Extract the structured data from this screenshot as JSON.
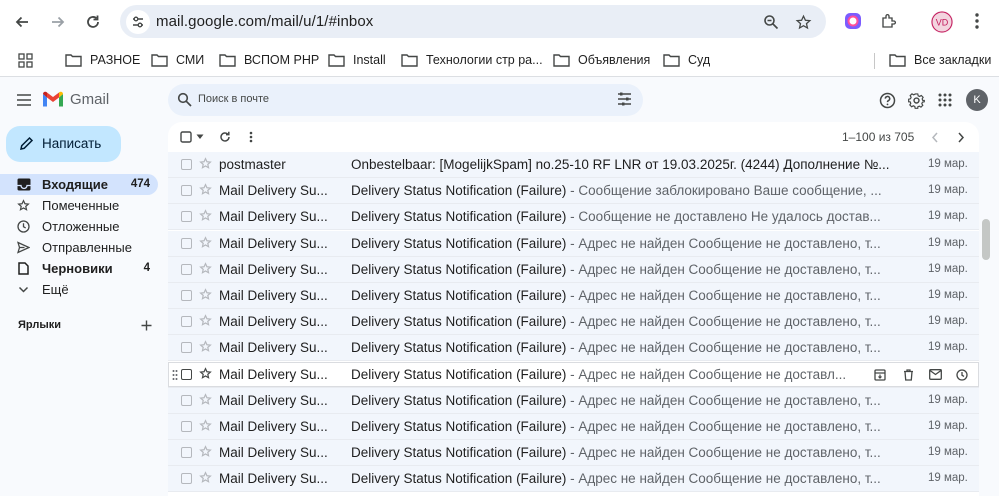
{
  "browser": {
    "url": "mail.google.com/mail/u/1/#inbox",
    "profile_initials": "VD",
    "bookmarks": [
      {
        "label": "РАЗНОЕ"
      },
      {
        "label": "СМИ"
      },
      {
        "label": "ВСПОМ PHP"
      },
      {
        "label": "Install"
      },
      {
        "label": "Технологии стр ра..."
      },
      {
        "label": "Объявления"
      },
      {
        "label": "Суд"
      }
    ],
    "all_bookmarks": "Все закладки"
  },
  "gmail": {
    "logo_text": "Gmail",
    "search_placeholder": "Поиск в почте",
    "account_initial": "K",
    "compose_label": "Написать",
    "nav": [
      {
        "label": "Входящие",
        "count": "474",
        "icon": "inbox-icon",
        "active": true,
        "bold": true
      },
      {
        "label": "Помеченные",
        "count": "",
        "icon": "star-icon",
        "active": false,
        "bold": false
      },
      {
        "label": "Отложенные",
        "count": "",
        "icon": "clock-icon",
        "active": false,
        "bold": false
      },
      {
        "label": "Отправленные",
        "count": "",
        "icon": "send-icon",
        "active": false,
        "bold": false
      },
      {
        "label": "Черновики",
        "count": "4",
        "icon": "draft-icon",
        "active": false,
        "bold": true
      },
      {
        "label": "Ещё",
        "count": "",
        "icon": "chevron-down-icon",
        "active": false,
        "bold": false
      }
    ],
    "labels_title": "Ярлыки",
    "pager": "1–100 из 705",
    "emails": [
      {
        "sender": "postmaster",
        "subject": "Onbestelbaar: [MogelijkSpam] no.25-10  RF  LNR от 19.03.2025г. (4244) Дополнение №...",
        "snippet": "",
        "date": "19 мар."
      },
      {
        "sender": "Mail Delivery Su...",
        "subject": "Delivery Status Notification (Failure)",
        "snippet": "Сообщение заблокировано Ваше сообщение, ...",
        "date": "19 мар."
      },
      {
        "sender": "Mail Delivery Su...",
        "subject": "Delivery Status Notification (Failure)",
        "snippet": "Сообщение не доставлено Не удалось достав...",
        "date": "19 мар."
      },
      {
        "sender": "Mail Delivery Su...",
        "subject": "Delivery Status Notification (Failure)",
        "snippet": "Адрес не найден Сообщение не доставлено, т...",
        "date": "19 мар."
      },
      {
        "sender": "Mail Delivery Su...",
        "subject": "Delivery Status Notification (Failure)",
        "snippet": "Адрес не найден Сообщение не доставлено, т...",
        "date": "19 мар."
      },
      {
        "sender": "Mail Delivery Su...",
        "subject": "Delivery Status Notification (Failure)",
        "snippet": "Адрес не найден Сообщение не доставлено, т...",
        "date": "19 мар."
      },
      {
        "sender": "Mail Delivery Su...",
        "subject": "Delivery Status Notification (Failure)",
        "snippet": "Адрес не найден Сообщение не доставлено, т...",
        "date": "19 мар."
      },
      {
        "sender": "Mail Delivery Su...",
        "subject": "Delivery Status Notification (Failure)",
        "snippet": "Адрес не найден Сообщение не доставлено, т...",
        "date": "19 мар."
      },
      {
        "sender": "Mail Delivery Su...",
        "subject": "Delivery Status Notification (Failure)",
        "snippet": "Адрес не найден Сообщение не доставл...",
        "date": "",
        "hover": true
      },
      {
        "sender": "Mail Delivery Su...",
        "subject": "Delivery Status Notification (Failure)",
        "snippet": "Адрес не найден Сообщение не доставлено, т...",
        "date": "19 мар."
      },
      {
        "sender": "Mail Delivery Su...",
        "subject": "Delivery Status Notification (Failure)",
        "snippet": "Адрес не найден Сообщение не доставлено, т...",
        "date": "19 мар."
      },
      {
        "sender": "Mail Delivery Su...",
        "subject": "Delivery Status Notification (Failure)",
        "snippet": "Адрес не найден Сообщение не доставлено, т...",
        "date": "19 мар."
      },
      {
        "sender": "Mail Delivery Su...",
        "subject": "Delivery Status Notification (Failure)",
        "snippet": "Адрес не найден Сообщение не доставлено, т...",
        "date": "19 мар."
      }
    ]
  }
}
